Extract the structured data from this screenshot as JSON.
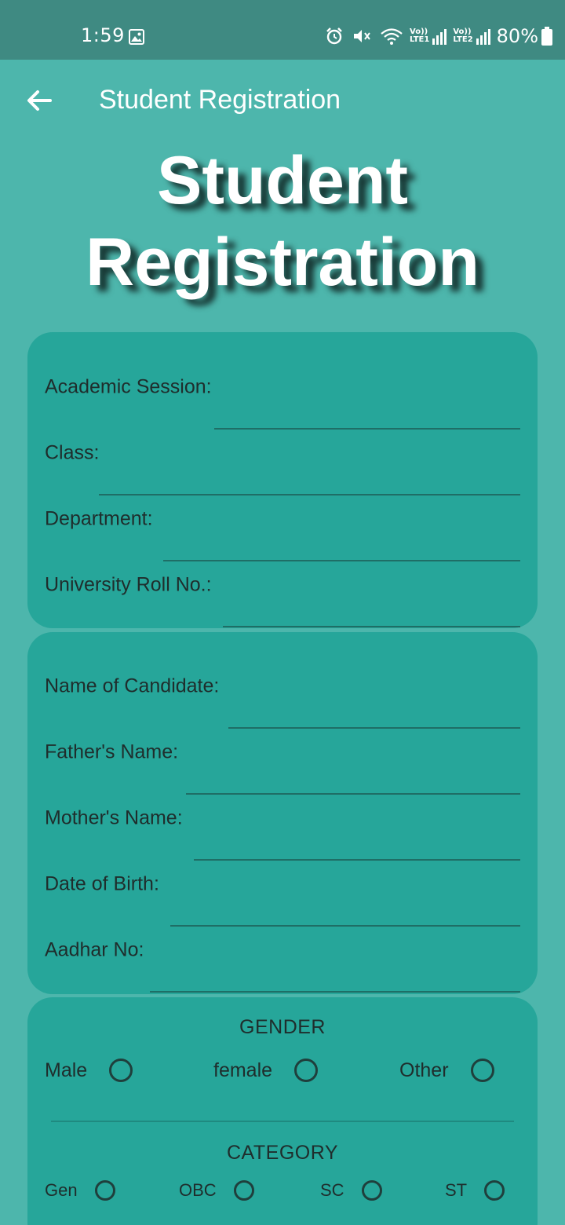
{
  "status_bar": {
    "time": "1:59",
    "battery": "80%",
    "sim1_top": "Vo))",
    "sim1_bottom": "LTE1",
    "sim2_top": "Vo))",
    "sim2_bottom": "LTE2"
  },
  "app_bar": {
    "title": "Student Registration"
  },
  "hero": {
    "line1": "Student",
    "line2": "Registration"
  },
  "academic": {
    "fields": [
      {
        "label": "Academic Session:",
        "value": ""
      },
      {
        "label": "Class:",
        "value": ""
      },
      {
        "label": "Department:",
        "value": ""
      },
      {
        "label": "University Roll No.:",
        "value": ""
      }
    ]
  },
  "personal": {
    "fields": [
      {
        "label": "Name of Candidate:",
        "value": ""
      },
      {
        "label": "Father's Name:",
        "value": ""
      },
      {
        "label": "Mother's Name:",
        "value": ""
      },
      {
        "label": "Date of Birth:",
        "value": ""
      },
      {
        "label": "Aadhar No:",
        "value": ""
      }
    ]
  },
  "gender": {
    "heading": "GENDER",
    "options": [
      "Male",
      "female",
      "Other"
    ]
  },
  "category": {
    "heading": "CATEGORY",
    "options": [
      "Gen",
      "OBC",
      "SC",
      "ST"
    ]
  },
  "colors": {
    "background": "#4db6ac",
    "status_bar": "#3f8a82",
    "card": "#26a69a"
  }
}
